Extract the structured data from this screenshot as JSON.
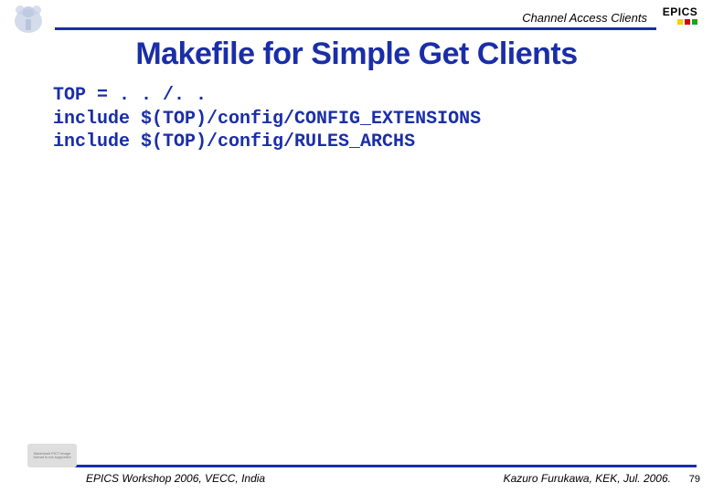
{
  "header": {
    "label": "Channel Access Clients",
    "logo_text": "EPICS"
  },
  "title": "Makefile for Simple Get Clients",
  "code": {
    "line1": "TOP = . . /. .",
    "line2": "include $(TOP)/config/CONFIG_EXTENSIONS",
    "line3": "include $(TOP)/config/RULES_ARCHS"
  },
  "placeholder": {
    "text": "Macintosh PICT image format is not supported"
  },
  "footer": {
    "left": "EPICS Workshop 2006, VECC, India",
    "right": "Kazuro Furukawa, KEK, Jul. 2006.",
    "page": "79"
  }
}
